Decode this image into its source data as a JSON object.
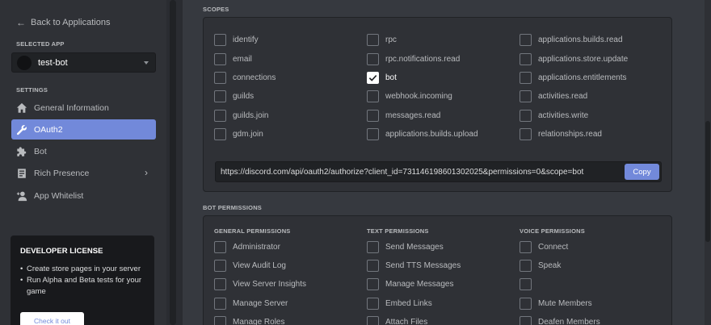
{
  "sidebar": {
    "back_label": "Back to Applications",
    "selected_app_heading": "SELECTED APP",
    "selected_app_name": "test-bot",
    "settings_heading": "SETTINGS",
    "nav": [
      {
        "label": "General Information",
        "icon": "home-icon",
        "active": false
      },
      {
        "label": "OAuth2",
        "icon": "wrench-icon",
        "active": true
      },
      {
        "label": "Bot",
        "icon": "puzzle-icon",
        "active": false
      },
      {
        "label": "Rich Presence",
        "icon": "document-icon",
        "active": false,
        "has_submenu": true
      },
      {
        "label": "App Whitelist",
        "icon": "user-add-icon",
        "active": false
      }
    ],
    "license": {
      "title": "DEVELOPER LICENSE",
      "bullets": [
        "Create store pages in your server",
        "Run Alpha and Beta tests for your game"
      ],
      "button_label": "Check it out"
    }
  },
  "scopes": {
    "heading": "SCOPES",
    "columns": [
      [
        {
          "label": "identify",
          "checked": false
        },
        {
          "label": "email",
          "checked": false
        },
        {
          "label": "connections",
          "checked": false
        },
        {
          "label": "guilds",
          "checked": false
        },
        {
          "label": "guilds.join",
          "checked": false
        },
        {
          "label": "gdm.join",
          "checked": false
        }
      ],
      [
        {
          "label": "rpc",
          "checked": false
        },
        {
          "label": "rpc.notifications.read",
          "checked": false
        },
        {
          "label": "bot",
          "checked": true
        },
        {
          "label": "webhook.incoming",
          "checked": false
        },
        {
          "label": "messages.read",
          "checked": false
        },
        {
          "label": "applications.builds.upload",
          "checked": false
        }
      ],
      [
        {
          "label": "applications.builds.read",
          "checked": false
        },
        {
          "label": "applications.store.update",
          "checked": false
        },
        {
          "label": "applications.entitlements",
          "checked": false
        },
        {
          "label": "activities.read",
          "checked": false
        },
        {
          "label": "activities.write",
          "checked": false
        },
        {
          "label": "relationships.read",
          "checked": false
        }
      ]
    ],
    "url": "https://discord.com/api/oauth2/authorize?client_id=731146198601302025&permissions=0&scope=bot",
    "copy_label": "Copy"
  },
  "bot_permissions": {
    "heading": "BOT PERMISSIONS",
    "columns": [
      {
        "heading": "GENERAL PERMISSIONS",
        "items": [
          "Administrator",
          "View Audit Log",
          "View Server Insights",
          "Manage Server",
          "Manage Roles"
        ]
      },
      {
        "heading": "TEXT PERMISSIONS",
        "items": [
          "Send Messages",
          "Send TTS Messages",
          "Manage Messages",
          "Embed Links",
          "Attach Files"
        ]
      },
      {
        "heading": "VOICE PERMISSIONS",
        "items": [
          "Connect",
          "Speak",
          "",
          "Mute Members",
          "Deafen Members"
        ]
      }
    ]
  },
  "colors": {
    "accent": "#7289da",
    "background": "#36393f",
    "sidebar": "#2f3136"
  }
}
